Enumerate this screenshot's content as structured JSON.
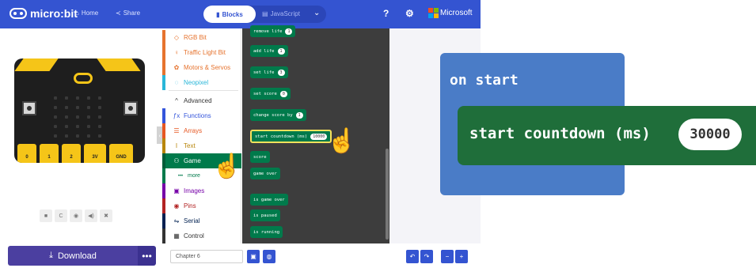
{
  "header": {
    "brand": "micro:bit",
    "home": "Home",
    "share": "Share",
    "blocks": "Blocks",
    "javascript": "JavaScript",
    "help_icon": "?",
    "settings_icon": "⚙",
    "microsoft": "Microsoft",
    "accent": "#3454d1"
  },
  "simulator": {
    "pins": [
      "0",
      "1",
      "2",
      "3V",
      "GND"
    ],
    "controls": [
      "■",
      "C",
      "◉",
      "◀)",
      "✖"
    ]
  },
  "toolbox": {
    "items": [
      {
        "label": "RGB Bit",
        "icon": "◇",
        "color": "#e6732e"
      },
      {
        "label": "Traffic Light Bit",
        "icon": "♀",
        "color": "#e6732e"
      },
      {
        "label": "Motors & Servos",
        "icon": "✿",
        "color": "#e6732e"
      },
      {
        "label": "Neopixel",
        "icon": "◌",
        "color": "#29b6d8"
      },
      {
        "label": "Advanced",
        "icon": "^",
        "color": "#333333"
      },
      {
        "label": "Functions",
        "icon": "ƒx",
        "color": "#3455db"
      },
      {
        "label": "Arrays",
        "icon": "☰",
        "color": "#e65722"
      },
      {
        "label": "Text",
        "icon": "I",
        "color": "#b8860b"
      },
      {
        "label": "Game",
        "icon": "⚇",
        "color": "#ffffff"
      },
      {
        "label": "more",
        "icon": "•••",
        "color": "#007a4b"
      },
      {
        "label": "Images",
        "icon": "▣",
        "color": "#7600a8"
      },
      {
        "label": "Pins",
        "icon": "◉",
        "color": "#b22222"
      },
      {
        "label": "Serial",
        "icon": "⇋",
        "color": "#002050"
      },
      {
        "label": "Control",
        "icon": "▦",
        "color": "#333333"
      }
    ]
  },
  "flyout": {
    "blocks": [
      {
        "label": "remove life",
        "value": "1"
      },
      {
        "label": "add life",
        "value": "1"
      },
      {
        "label": "set life",
        "value": "3"
      },
      {
        "label": "set score",
        "value": "0"
      },
      {
        "label": "change score by",
        "value": "1"
      },
      {
        "label": "start countdown (ms)",
        "value": "10000"
      },
      {
        "label": "score",
        "value": ""
      },
      {
        "label": "game over",
        "value": ""
      },
      {
        "label": "is game over",
        "value": ""
      },
      {
        "label": "is paused",
        "value": ""
      },
      {
        "label": "is running",
        "value": ""
      }
    ]
  },
  "bottom": {
    "download": "Download",
    "more": "•••",
    "project_name": "Chapter 6"
  },
  "zoom": {
    "event": "on start",
    "block": "start countdown (ms)",
    "value": "30000",
    "event_color": "#4a7cc7",
    "block_color": "#1f6e3a"
  }
}
